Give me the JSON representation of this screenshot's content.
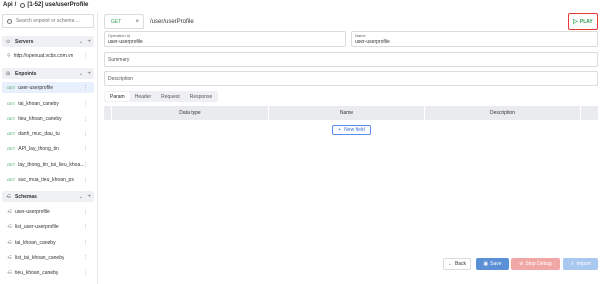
{
  "title": {
    "prefix": "Api",
    "separator": "/",
    "name": "[1-52] use/userProfile"
  },
  "sidebar": {
    "search_placeholder": "Search enpoint or schema ...",
    "servers": {
      "label": "Servers",
      "items": [
        {
          "label": "http://openuat.vcbs.com.vn"
        }
      ]
    },
    "endpoints": {
      "label": "Enpoints",
      "items": [
        {
          "method": "GET",
          "label": "user-userprofile",
          "active": true
        },
        {
          "method": "GET",
          "label": "tai_khoan_caneby"
        },
        {
          "method": "GET",
          "label": "tieu_khoan_caneby"
        },
        {
          "method": "GET",
          "label": "danh_muc_dau_tu"
        },
        {
          "method": "GET",
          "label": "API_lay_thong_tin"
        },
        {
          "method": "GET",
          "label": "lay_thong_tin_tai_lieu_khoa..."
        },
        {
          "method": "GET",
          "label": "suc_mua_tieu_khoan_ps"
        }
      ]
    },
    "schemas": {
      "label": "Schemas",
      "items": [
        {
          "label": "user-userprofile"
        },
        {
          "label": "list_user-userprofile"
        },
        {
          "label": "tai_khoan_caneby"
        },
        {
          "label": "list_tai_khoan_caneby"
        },
        {
          "label": "tieu_khoan_caneby"
        }
      ]
    }
  },
  "request": {
    "method": "GET",
    "url": "/user/userProfile",
    "play_label": "PLAY"
  },
  "form": {
    "operation_id_label": "Operation Id",
    "operation_id_value": "user-userprofile",
    "name_label": "Name",
    "name_value": "user-userprofile",
    "summary_placeholder": "Summary",
    "description_placeholder": "Description"
  },
  "tabs": [
    {
      "label": "Param",
      "active": true
    },
    {
      "label": "Header"
    },
    {
      "label": "Request"
    },
    {
      "label": "Response"
    }
  ],
  "table": {
    "columns": [
      "Data type",
      "Name",
      "Description"
    ]
  },
  "new_field_label": "New field",
  "footer": {
    "back": "Back",
    "save": "Save",
    "stop_debug": "Stop Debug",
    "import": "Import"
  },
  "colors": {
    "method_get": "#2e9e4f",
    "play_outline": "#e53935",
    "save_bg": "#5b8fd6",
    "stop_debug_bg": "#f2a7a7",
    "import_bg": "#a8c8f0"
  }
}
